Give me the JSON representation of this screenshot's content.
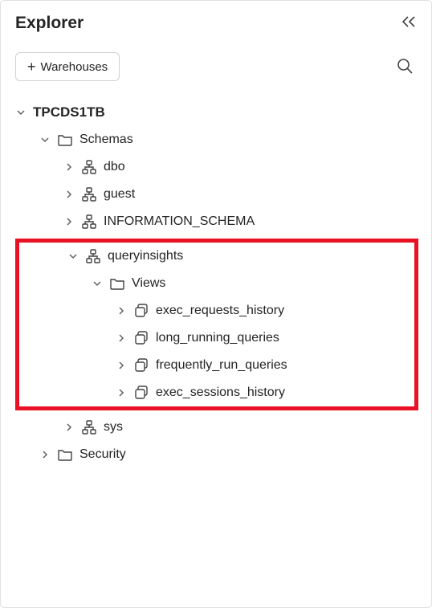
{
  "header": {
    "title": "Explorer"
  },
  "toolbar": {
    "warehouses_label": "Warehouses"
  },
  "tree": {
    "database": {
      "name": "TPCDS1TB",
      "schemas": {
        "label": "Schemas",
        "items": {
          "dbo": "dbo",
          "guest": "guest",
          "information_schema": "INFORMATION_SCHEMA",
          "queryinsights": {
            "name": "queryinsights",
            "views": {
              "label": "Views",
              "items": {
                "exec_requests_history": "exec_requests_history",
                "long_running_queries": "long_running_queries",
                "frequently_run_queries": "frequently_run_queries",
                "exec_sessions_history": "exec_sessions_history"
              }
            }
          },
          "sys": "sys"
        }
      },
      "security": {
        "label": "Security"
      }
    }
  }
}
